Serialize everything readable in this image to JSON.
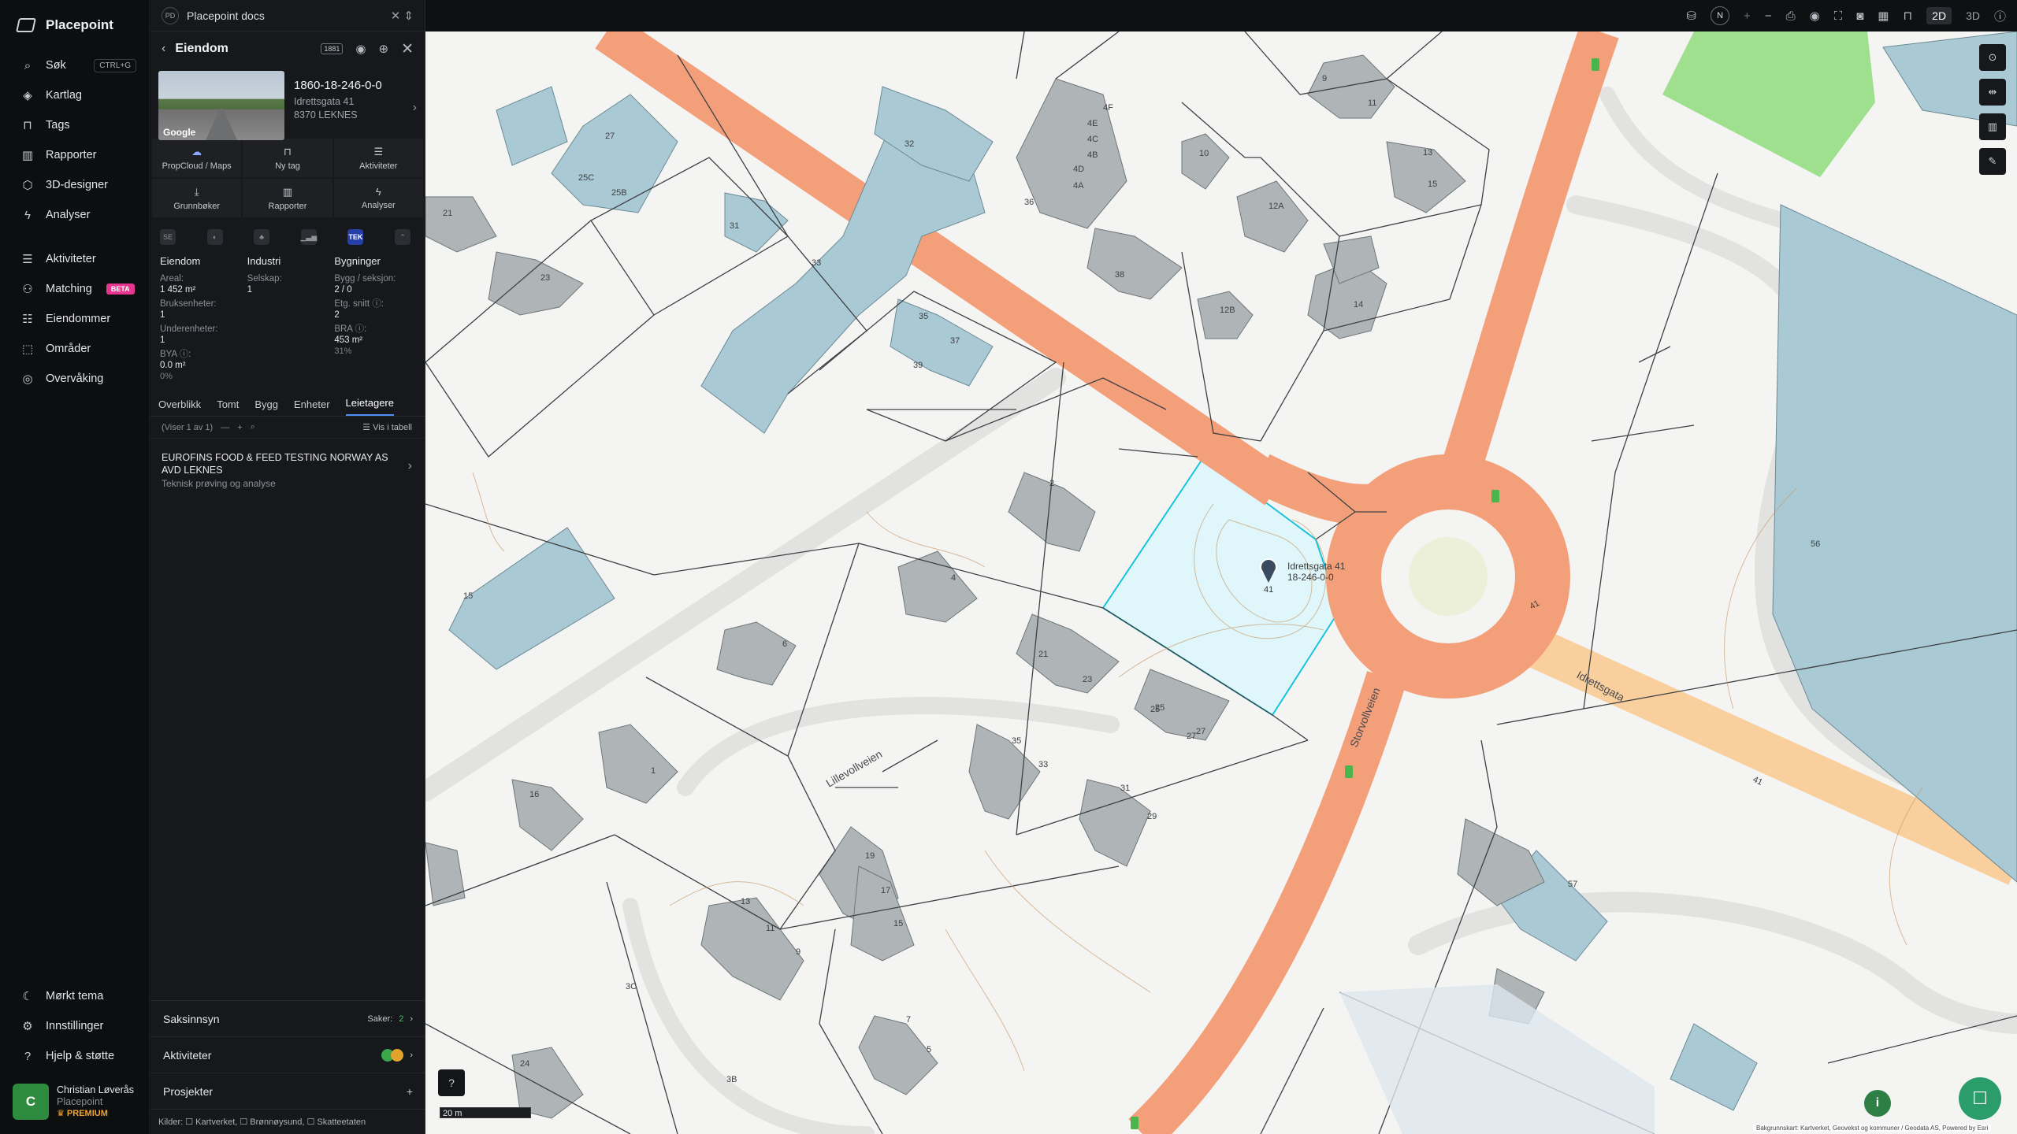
{
  "nav": {
    "brand": "Placepoint",
    "items": [
      {
        "label": "Søk",
        "icon": "search-icon",
        "shortcut": "CTRL+G"
      },
      {
        "label": "Kartlag",
        "icon": "layers-icon"
      },
      {
        "label": "Tags",
        "icon": "bookmark-icon"
      },
      {
        "label": "Rapporter",
        "icon": "chart-icon"
      },
      {
        "label": "3D-designer",
        "icon": "cube-icon"
      },
      {
        "label": "Analyser",
        "icon": "bolt-icon"
      }
    ],
    "items2": [
      {
        "label": "Aktiviteter",
        "icon": "chat-icon"
      },
      {
        "label": "Matching",
        "icon": "match-icon",
        "badge": "BETA"
      },
      {
        "label": "Eiendommer",
        "icon": "stack-icon"
      },
      {
        "label": "Områder",
        "icon": "area-icon"
      },
      {
        "label": "Overvåking",
        "icon": "eye-icon"
      }
    ],
    "bottom": [
      {
        "label": "Mørkt tema",
        "icon": "moon-icon"
      },
      {
        "label": "Innstillinger",
        "icon": "gear-icon"
      },
      {
        "label": "Hjelp & støtte",
        "icon": "help-icon"
      }
    ],
    "user": {
      "initial": "C",
      "name": "Christian Løverås",
      "org": "Placepoint",
      "plan": "PREMIUM"
    }
  },
  "doc": {
    "badge": "PD",
    "title": "Placepoint docs"
  },
  "panel": {
    "title": "Eiendom",
    "tool_badge": "1881",
    "property": {
      "id": "1860-18-246-0-0",
      "street": "Idrettsgata 41",
      "city": "8370 LEKNES",
      "thumb_logo": "Google"
    },
    "actions": [
      {
        "label": "PropCloud / Maps"
      },
      {
        "label": "Ny tag"
      },
      {
        "label": "Aktiviteter"
      },
      {
        "label": "Grunnbøker"
      },
      {
        "label": "Rapporter"
      },
      {
        "label": "Analyser"
      }
    ],
    "sources_icons": [
      "SE",
      "",
      "",
      "",
      "TEK",
      ""
    ],
    "stats": {
      "col1": {
        "head": "Eiendom",
        "rows": [
          {
            "k": "Areal:",
            "v": "1 452 m²"
          },
          {
            "k": "Bruksenheter:",
            "v": "1"
          },
          {
            "k": "Underenheter:",
            "v": "1"
          },
          {
            "k": "BYA ⓘ:",
            "v": "0.0 m²",
            "p": "0%"
          }
        ]
      },
      "col2": {
        "head": "Industri",
        "rows": [
          {
            "k": "Selskap:",
            "v": "1"
          }
        ]
      },
      "col3": {
        "head": "Bygninger",
        "rows": [
          {
            "k": "Bygg / seksjon:",
            "v": "2 / 0"
          },
          {
            "k": "Etg. snitt ⓘ:",
            "v": "2"
          },
          {
            "k": "BRA ⓘ:",
            "v": "453 m²",
            "p": "31%"
          }
        ]
      }
    },
    "tabs": [
      "Overblikk",
      "Tomt",
      "Bygg",
      "Enheter",
      "Leietagere"
    ],
    "active_tab": "Leietagere",
    "list": {
      "count": "(Viser 1 av 1)",
      "table_label": "Vis i tabell"
    },
    "tenant": {
      "name": "EUROFINS FOOD & FEED TESTING NORWAY AS AVD LEKNES",
      "sub": "Teknisk prøving og analyse"
    },
    "sections": [
      {
        "label": "Saksinnsyn",
        "meta": "Saker:",
        "count": "2"
      },
      {
        "label": "Aktiviteter"
      },
      {
        "label": "Prosjekter",
        "plus": "+"
      }
    ],
    "sources": "Kilder: ☐ Kartverket, ☐ Brønnøysund, ☐ Skatteetaten"
  },
  "map": {
    "marker_label_addr": "Idrettsgata 41",
    "marker_label_id": "18-246-0-0",
    "marker_num": "41",
    "street_labels": [
      "Storvollveien",
      "Idrettsgata",
      "Lillevollveien"
    ],
    "house_numbers": [
      "2",
      "4",
      "6",
      "1",
      "16",
      "21",
      "23",
      "25",
      "27",
      "25C",
      "25B",
      "27",
      "31",
      "33",
      "35",
      "37",
      "39",
      "32",
      "36",
      "4F",
      "4E",
      "4D",
      "4C",
      "4B",
      "4A",
      "38",
      "10",
      "9",
      "11",
      "12A",
      "12B",
      "13",
      "15",
      "14",
      "23",
      "21",
      "25",
      "27",
      "31",
      "29",
      "35",
      "33",
      "19",
      "17",
      "15",
      "13",
      "11",
      "9",
      "7",
      "5",
      "24",
      "3C",
      "3B",
      "15",
      "56",
      "57",
      "41",
      "41"
    ],
    "scale": "20 m",
    "north": "N",
    "view_2d": "2D",
    "view_3d": "3D",
    "attribution": "Bakgrunnskart: Kartverket, Geovekst og kommuner / Geodata AS, Powered by Esri"
  }
}
